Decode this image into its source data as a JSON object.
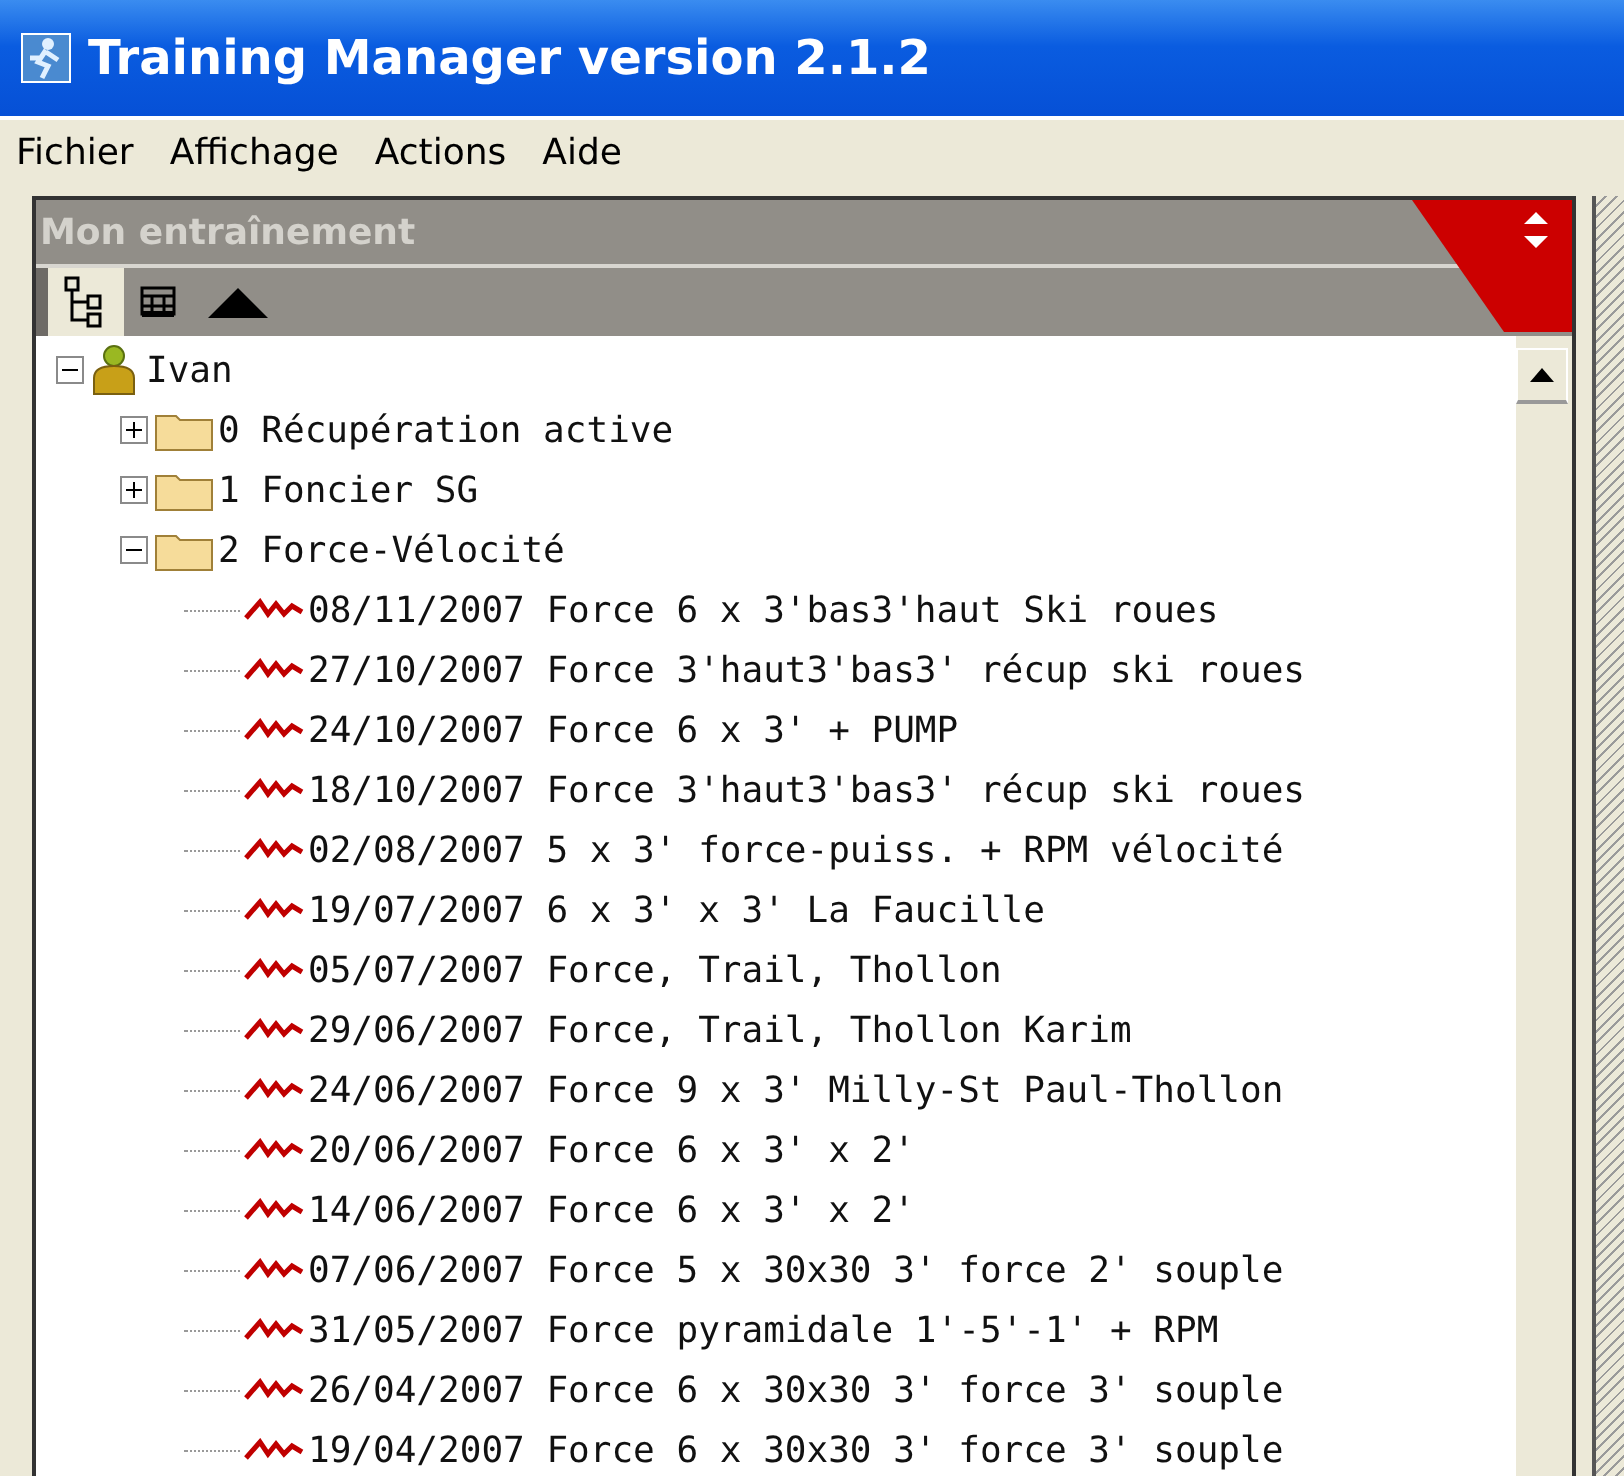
{
  "window": {
    "title": "Training Manager version 2.1.2"
  },
  "menu": [
    "Fichier",
    "Affichage",
    "Actions",
    "Aide"
  ],
  "panel": {
    "title": "Mon entraînement"
  },
  "toolbar": [
    {
      "kind": "tree",
      "selected": true
    },
    {
      "kind": "grid",
      "selected": false
    },
    {
      "kind": "collapse",
      "selected": false
    }
  ],
  "tree": [
    {
      "kind": "person",
      "label": "Ivan",
      "expanded": true,
      "children": [
        {
          "kind": "folder",
          "label": "0 Récupération active",
          "expanded": false
        },
        {
          "kind": "folder",
          "label": "1 Foncier SG",
          "expanded": false
        },
        {
          "kind": "folder",
          "label": "2 Force-Vélocité",
          "expanded": true,
          "children": [
            {
              "kind": "session",
              "label": "08/11/2007 Force 6 x 3'bas3'haut Ski roues"
            },
            {
              "kind": "session",
              "label": "27/10/2007 Force 3'haut3'bas3' récup ski roues"
            },
            {
              "kind": "session",
              "label": "24/10/2007 Force 6 x 3' + PUMP"
            },
            {
              "kind": "session",
              "label": "18/10/2007 Force 3'haut3'bas3' récup ski roues"
            },
            {
              "kind": "session",
              "label": "02/08/2007 5 x 3' force-puiss. + RPM vélocité"
            },
            {
              "kind": "session",
              "label": "19/07/2007 6 x 3' x 3' La Faucille"
            },
            {
              "kind": "session",
              "label": "05/07/2007 Force, Trail, Thollon"
            },
            {
              "kind": "session",
              "label": "29/06/2007 Force, Trail, Thollon Karim"
            },
            {
              "kind": "session",
              "label": "24/06/2007 Force 9 x 3' Milly-St Paul-Thollon"
            },
            {
              "kind": "session",
              "label": "20/06/2007 Force 6 x 3' x 2'"
            },
            {
              "kind": "session",
              "label": "14/06/2007 Force 6 x 3' x 2'"
            },
            {
              "kind": "session",
              "label": "07/06/2007 Force 5 x 30x30 3' force 2' souple"
            },
            {
              "kind": "session",
              "label": "31/05/2007 Force pyramidale 1'-5'-1' + RPM"
            },
            {
              "kind": "session",
              "label": "26/04/2007 Force 6 x 30x30 3' force 3' souple"
            },
            {
              "kind": "session",
              "label": "19/04/2007 Force 6 x 30x30 3' force 3' souple"
            }
          ]
        }
      ]
    }
  ]
}
